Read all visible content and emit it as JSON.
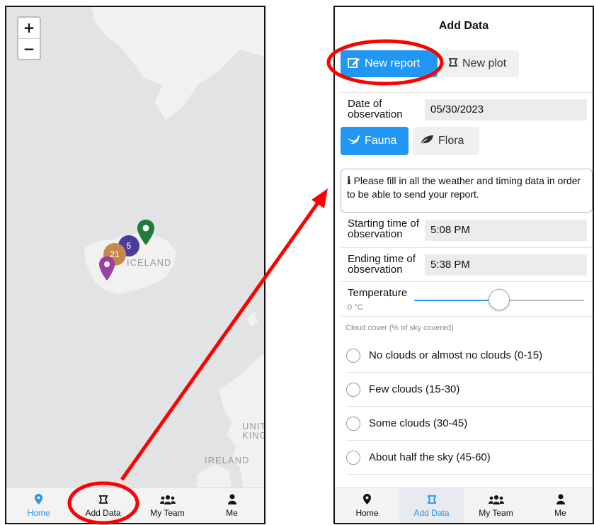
{
  "colors": {
    "accent": "#2196f3",
    "annotation": "#ff0000",
    "cluster_orange": "#c8874a",
    "cluster_purple": "#4b3b9a",
    "pin_green": "#1f7a3c",
    "pin_purple": "#9b3fa8"
  },
  "map": {
    "zoom_in": "+",
    "zoom_out": "−",
    "labels": {
      "iceland": "ICELAND",
      "uk": "UNIT KINGD",
      "ireland": "IRELAND"
    },
    "clusters": [
      {
        "count": "21"
      },
      {
        "count": "5"
      }
    ]
  },
  "tabbar_left": [
    {
      "label": "Home",
      "icon": "location-pin-icon"
    },
    {
      "label": "Add Data",
      "icon": "plot-square-icon"
    },
    {
      "label": "My Team",
      "icon": "team-icon"
    },
    {
      "label": "Me",
      "icon": "user-icon"
    }
  ],
  "form": {
    "title": "Add Data",
    "new_report": "New report",
    "new_plot": "New plot",
    "date_label": "Date of observation",
    "date_value": "05/30/2023",
    "fauna": "Fauna",
    "flora": "Flora",
    "notice": "Please fill in all the weather and timing data in order to be able to send your report.",
    "start_label": "Starting time of observation",
    "start_value": "5:08 PM",
    "end_label": "Ending time of observation",
    "end_value": "5:38 PM",
    "temperature_label": "Temperature",
    "temperature_value": "0 °C",
    "temperature_fraction": 0.5,
    "cloud_label": "Cloud cover (% of sky covered)",
    "cloud_options": [
      "No clouds or almost no clouds (0-15)",
      "Few clouds (15-30)",
      "Some clouds (30-45)",
      "About half the sky (45-60)"
    ]
  },
  "tabbar_right": [
    {
      "label": "Home",
      "icon": "location-pin-icon"
    },
    {
      "label": "Add Data",
      "icon": "plot-square-icon"
    },
    {
      "label": "My Team",
      "icon": "team-icon"
    },
    {
      "label": "Me",
      "icon": "user-icon"
    }
  ]
}
